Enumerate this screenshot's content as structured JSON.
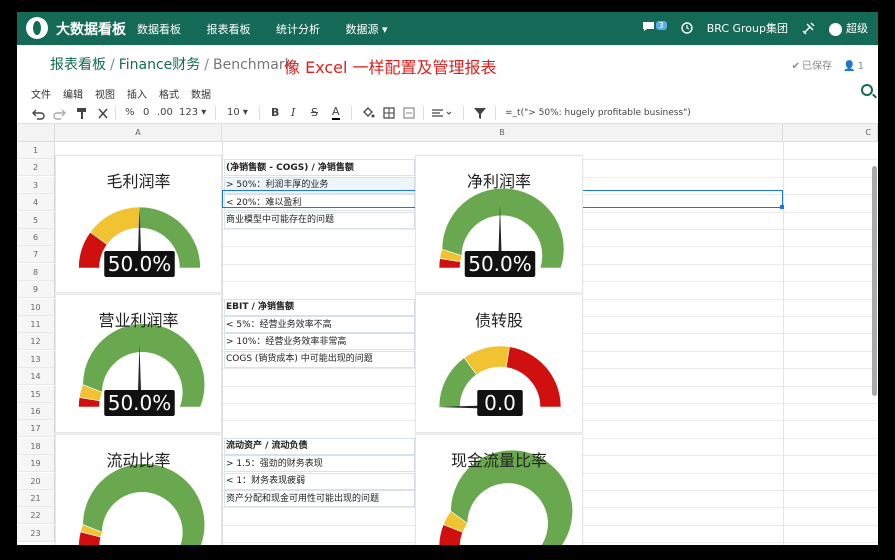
{
  "nav": {
    "brand": "大数据看板",
    "menu": [
      "数据看板",
      "报表看板",
      "统计分析",
      "数据源 ▾"
    ],
    "chat_count": "3",
    "company": "BRC Group集团",
    "user": "超级"
  },
  "breadcrumb": {
    "items": [
      "报表看板",
      "Finance财务"
    ],
    "current": "Benchmark",
    "title": "像 Excel 一样配置及管理报表",
    "saved": "已保存",
    "user_count": "1"
  },
  "menubar": [
    "文件",
    "编辑",
    "视图",
    "插入",
    "格式",
    "数据"
  ],
  "toolbar": {
    "percent": "%",
    "dec_zero": "0",
    "dec_two": ".00",
    "number": "123 ▾",
    "font_size": "10 ▾",
    "bold": "B",
    "italic": "I",
    "strike": "S",
    "text_color": "A",
    "formula": "=_t(\"> 50%: hugely profitable business\")"
  },
  "grid": {
    "columns": [
      "A",
      "B",
      "C"
    ],
    "rows": [
      "1",
      "2",
      "3",
      "4",
      "5",
      "6",
      "7",
      "8",
      "9",
      "10",
      "11",
      "12",
      "13",
      "14",
      "15",
      "16",
      "17",
      "18",
      "19",
      "20",
      "21",
      "22",
      "23"
    ]
  },
  "notes": [
    {
      "row": 2,
      "text": "(净销售额 - COGS) / 净销售额",
      "bold": true
    },
    {
      "row": 3,
      "text": "> 50%：利润丰厚的业务",
      "bold": false
    },
    {
      "row": 4,
      "text": "< 20%：难以盈利",
      "bold": false
    },
    {
      "row": 5,
      "text": "商业模型中可能存在的问题",
      "bold": false
    },
    {
      "row": 10,
      "text": "EBIT / 净销售额",
      "bold": true
    },
    {
      "row": 11,
      "text": "< 5%：经营业务效率不高",
      "bold": false
    },
    {
      "row": 12,
      "text": "> 10%：经营业务效率非常高",
      "bold": false
    },
    {
      "row": 13,
      "text": "COGS (销货成本) 中可能出现的问题",
      "bold": false
    },
    {
      "row": 18,
      "text": "流动资产 / 流动负债",
      "bold": true
    },
    {
      "row": 19,
      "text": "> 1.5：强劲的财务表现",
      "bold": false
    },
    {
      "row": 20,
      "text": "< 1：财务表现疲弱",
      "bold": false
    },
    {
      "row": 21,
      "text": "资产分配和现金可用性可能出现的问题",
      "bold": false
    }
  ],
  "gauges": [
    {
      "title": "毛利润率",
      "value_label": "50.0%",
      "fraction": 0.5,
      "segments": [
        0.2,
        0.5,
        1.0
      ]
    },
    {
      "title": "净利润率",
      "value_label": "50.0%",
      "fraction": 0.5,
      "segments": [
        0.05,
        0.1,
        1.0
      ]
    },
    {
      "title": "营业利润率",
      "value_label": "50.0%",
      "fraction": 0.5,
      "segments": [
        0.05,
        0.12,
        1.0
      ]
    },
    {
      "title": "债转股",
      "value_label": "0.0",
      "fraction": 0.0,
      "segments": [
        0.3,
        0.55,
        1.0
      ],
      "reverse": true
    },
    {
      "title": "流动比率",
      "value_label": "",
      "fraction": 0.0,
      "segments": [
        0.08,
        0.12,
        1.0
      ]
    },
    {
      "title": "现金流量比率",
      "value_label": "",
      "fraction": 0.0,
      "segments": [
        0.12,
        0.2,
        1.0
      ]
    }
  ],
  "colors": {
    "red": "#d00f0f",
    "yellow": "#f1c232",
    "green": "#6aa84f",
    "brand": "#146a57"
  }
}
